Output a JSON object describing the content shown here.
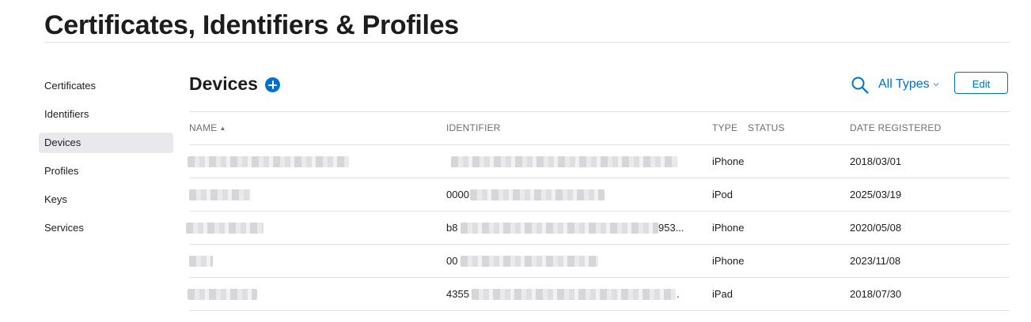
{
  "page": {
    "title": "Certificates, Identifiers & Profiles"
  },
  "sidebar": {
    "items": [
      {
        "label": "Certificates"
      },
      {
        "label": "Identifiers"
      },
      {
        "label": "Devices",
        "active": true
      },
      {
        "label": "Profiles"
      },
      {
        "label": "Keys"
      },
      {
        "label": "Services"
      }
    ]
  },
  "main": {
    "section_title": "Devices",
    "add_icon": "plus-circle-icon",
    "search_icon": "search-icon",
    "type_filter": "All Types",
    "edit_label": "Edit",
    "accent_color": "#0070c9"
  },
  "table": {
    "columns": {
      "name": "NAME",
      "identifier": "IDENTIFIER",
      "type": "TYPE",
      "status": "STATUS",
      "date": "DATE REGISTERED"
    },
    "sort": {
      "column": "name",
      "direction": "ascending"
    },
    "rows": [
      {
        "id_prefix": "",
        "id_suffix": "",
        "type": "iPhone",
        "date": "2018/03/01"
      },
      {
        "id_prefix": "0000",
        "id_suffix": "",
        "type": "iPod",
        "date": "2025/03/19"
      },
      {
        "id_prefix": "b8",
        "id_suffix": "953...",
        "type": "iPhone",
        "date": "2020/05/08"
      },
      {
        "id_prefix": "00",
        "id_suffix": "",
        "type": "iPhone",
        "date": "2023/11/08"
      },
      {
        "id_prefix": "4355",
        "id_suffix": ".",
        "type": "iPad",
        "date": "2018/07/30"
      }
    ]
  }
}
